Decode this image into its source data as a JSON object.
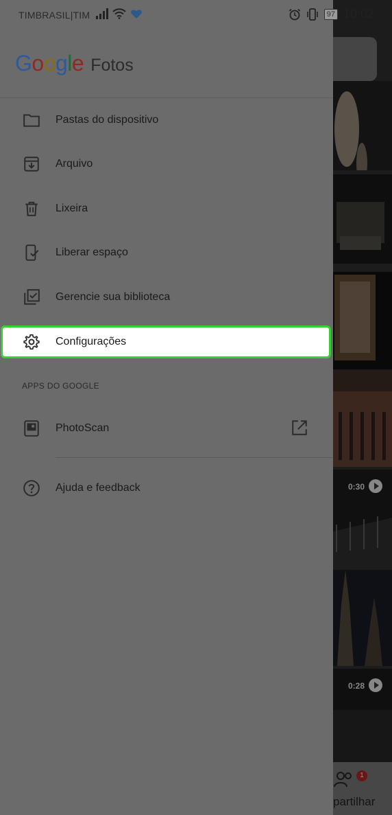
{
  "status_bar": {
    "carrier": "TIMBRASIL|TIM",
    "battery": "97",
    "time": "10:02"
  },
  "drawer": {
    "logo": {
      "google": "Google",
      "product": "Fotos"
    },
    "menu": [
      {
        "label": "Pastas do dispositivo",
        "icon": "folder-icon"
      },
      {
        "label": "Arquivo",
        "icon": "archive-icon"
      },
      {
        "label": "Lixeira",
        "icon": "trash-icon"
      },
      {
        "label": "Liberar espaço",
        "icon": "phone-check-icon"
      },
      {
        "label": "Gerencie sua biblioteca",
        "icon": "library-check-icon"
      },
      {
        "label": "Configurações",
        "icon": "gear-icon"
      }
    ],
    "apps_section_label": "APPS DO GOOGLE",
    "apps": [
      {
        "label": "PhotoScan",
        "icon": "photoscan-icon",
        "trailing_icon": "open-external-icon"
      }
    ],
    "help": {
      "label": "Ajuda e feedback",
      "icon": "help-icon"
    }
  },
  "background": {
    "video_durations": [
      "0:30",
      "0:28"
    ],
    "share_label": "partilhar",
    "share_badge": "1"
  },
  "colors": {
    "highlight_border": "#35d12e",
    "drawer_bg": "#6b6b6b"
  }
}
